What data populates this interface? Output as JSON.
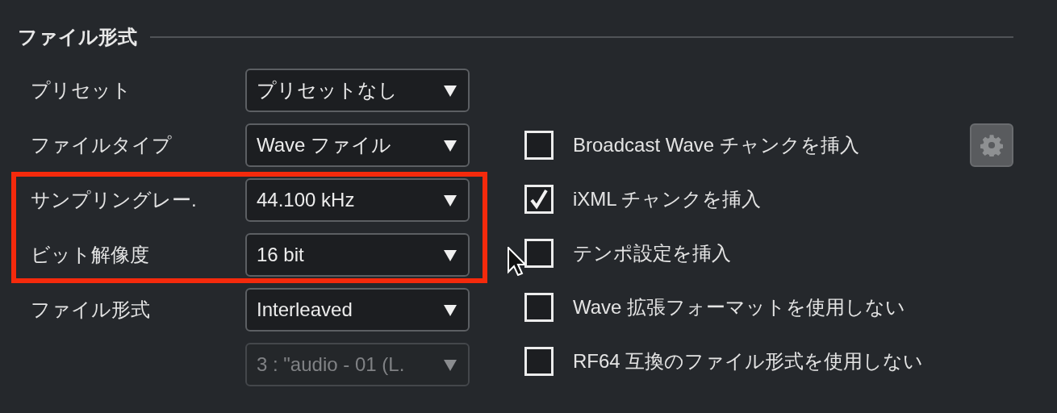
{
  "section": {
    "title": "ファイル形式"
  },
  "rows": [
    {
      "label": "プリセット",
      "value": "プリセットなし",
      "disabled": false,
      "highlighted": false
    },
    {
      "label": "ファイルタイプ",
      "value": "Wave ファイル",
      "disabled": false,
      "highlighted": false
    },
    {
      "label": "サンプリングレー.",
      "value": "44.100 kHz",
      "disabled": false,
      "highlighted": true
    },
    {
      "label": "ビット解像度",
      "value": "16 bit",
      "disabled": false,
      "highlighted": true
    },
    {
      "label": "ファイル形式",
      "value": "Interleaved",
      "disabled": false,
      "highlighted": false
    },
    {
      "value": "3 : \"audio - 01 (L.",
      "disabled": true,
      "highlighted": false
    }
  ],
  "options": [
    {
      "label": "Broadcast Wave チャンクを挿入",
      "checked": false,
      "has_settings": true
    },
    {
      "label": "iXML チャンクを挿入",
      "checked": true,
      "has_settings": false
    },
    {
      "label": "テンポ設定を挿入",
      "checked": false,
      "has_settings": false
    },
    {
      "label": "Wave 拡張フォーマットを使用しない",
      "checked": false,
      "has_settings": false
    },
    {
      "label": "RF64 互換のファイル形式を使用しない",
      "checked": false,
      "has_settings": false
    }
  ]
}
